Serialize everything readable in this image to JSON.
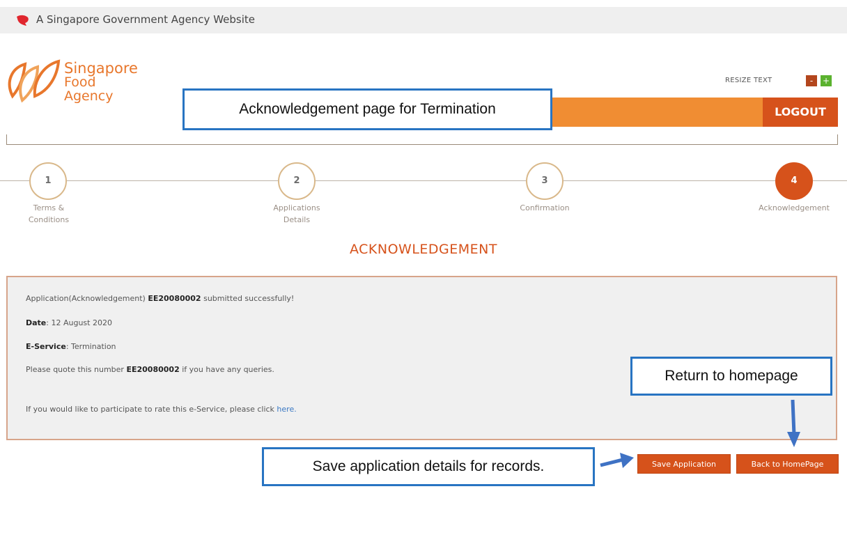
{
  "gov_banner": {
    "text": "A Singapore Government Agency Website",
    "icon": "lion-head-icon"
  },
  "logo": {
    "line1": "Singapore",
    "line2": "Food",
    "line3": "Agency",
    "icon": "sfa-leaf-logo"
  },
  "resize": {
    "label": "RESIZE TEXT",
    "minus": "-",
    "plus": "+"
  },
  "header": {
    "logout_label": "LOGOUT"
  },
  "steps": [
    {
      "number": "1",
      "label_line1": "Terms &",
      "label_line2": "Conditions"
    },
    {
      "number": "2",
      "label_line1": "Applications",
      "label_line2": "Details"
    },
    {
      "number": "3",
      "label_line1": "Confirmation",
      "label_line2": ""
    },
    {
      "number": "4",
      "label_line1": "Acknowledgement",
      "label_line2": ""
    }
  ],
  "active_step": 4,
  "ack": {
    "title": "ACKNOWLEDGEMENT",
    "line1_prefix": "Application(Acknowledgement)",
    "app_number": "EE20080002",
    "line1_suffix": "submitted successfully!",
    "date_label": "Date",
    "date_value": ": 12 August 2020",
    "service_label": "E-Service",
    "service_value": ": Termination",
    "quote_prefix": "Please quote this number",
    "quote_suffix": "if you have any queries.",
    "rate_prefix": "If you would like to participate to rate this e-Service, please click",
    "rate_link": "here."
  },
  "buttons": {
    "save": "Save Application",
    "home": "Back to HomePage"
  },
  "callouts": {
    "termination": "Acknowledgement page for Termination",
    "return": "Return to homepage",
    "save": "Save application details for records."
  },
  "colors": {
    "brand_orange": "#d6521b",
    "bar_orange": "#f08d33",
    "callout_border": "#2874c2"
  }
}
